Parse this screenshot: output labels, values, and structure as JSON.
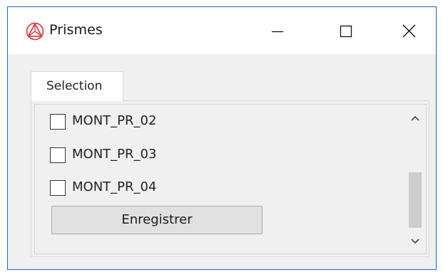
{
  "window": {
    "title": "Prismes",
    "app_icon": "prism-logo-icon",
    "controls": {
      "minimize_icon": "minimize-icon",
      "maximize_icon": "maximize-icon",
      "close_icon": "close-icon"
    },
    "accent_color": "#1a6fd0"
  },
  "tabs": [
    {
      "label": "Selection",
      "selected": true
    }
  ],
  "list": {
    "items": [
      {
        "label": "MONT_PR_02",
        "checked": false
      },
      {
        "label": "MONT_PR_03",
        "checked": false
      },
      {
        "label": "MONT_PR_04",
        "checked": false
      }
    ],
    "save_label": "Enregistrer"
  },
  "scrollbar": {
    "up_icon": "chevron-up-icon",
    "down_icon": "chevron-down-icon",
    "position_fraction": 1.0
  }
}
